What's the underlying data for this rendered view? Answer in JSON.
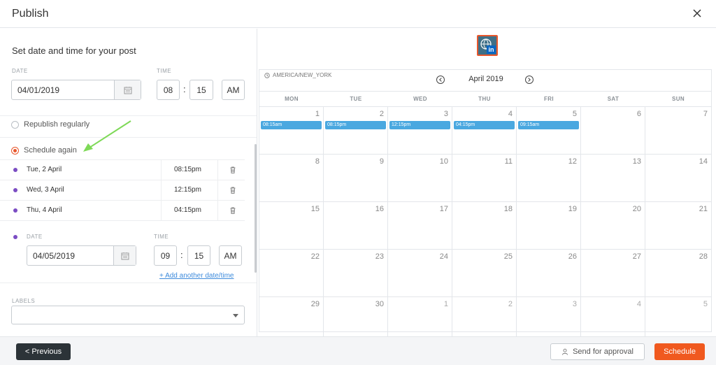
{
  "header": {
    "title": "Publish"
  },
  "left": {
    "section_title": "Set date and time for your post",
    "date_label": "DATE",
    "time_label": "TIME",
    "date_value": "04/01/2019",
    "hour": "08",
    "minute": "15",
    "ampm": "AM",
    "republish_label": "Republish regularly",
    "schedule_again_label": "Schedule again",
    "scheduled": [
      {
        "date": "Tue, 2 April",
        "time": "08:15pm"
      },
      {
        "date": "Wed, 3 April",
        "time": "12:15pm"
      },
      {
        "date": "Thu, 4 April",
        "time": "04:15pm"
      }
    ],
    "new_date_label": "DATE",
    "new_time_label": "TIME",
    "new_date_value": "04/05/2019",
    "new_hour": "09",
    "new_minute": "15",
    "new_ampm": "AM",
    "add_link": "+ Add another date/time",
    "labels_label": "LABELS",
    "colon": ":"
  },
  "calendar": {
    "timezone": "AMERICA/NEW_YORK",
    "month": "April 2019",
    "weekdays": [
      "MON",
      "TUE",
      "WED",
      "THU",
      "FRI",
      "SAT",
      "SUN"
    ],
    "weeks": [
      [
        "1",
        "2",
        "3",
        "4",
        "5",
        "6",
        "7"
      ],
      [
        "8",
        "9",
        "10",
        "11",
        "12",
        "13",
        "14"
      ],
      [
        "15",
        "16",
        "17",
        "18",
        "19",
        "20",
        "21"
      ],
      [
        "22",
        "23",
        "24",
        "25",
        "26",
        "27",
        "28"
      ],
      [
        "29",
        "30",
        "1",
        "2",
        "3",
        "4",
        "5"
      ]
    ],
    "events": [
      {
        "day_index": 0,
        "time": "08:15am"
      },
      {
        "day_index": 1,
        "time": "08:15pm"
      },
      {
        "day_index": 2,
        "time": "12:15pm"
      },
      {
        "day_index": 3,
        "time": "04:15pm"
      },
      {
        "day_index": 4,
        "time": "09:15am"
      }
    ],
    "event_color": "#4aa8e0",
    "network_badge": "in"
  },
  "footer": {
    "previous": "< Previous",
    "send_approval": "Send for approval",
    "schedule": "Schedule"
  },
  "colors": {
    "accent": "#f0591f",
    "dot": "#7b4dc3",
    "link": "#3e8bdc",
    "arrow": "#7ed957"
  }
}
